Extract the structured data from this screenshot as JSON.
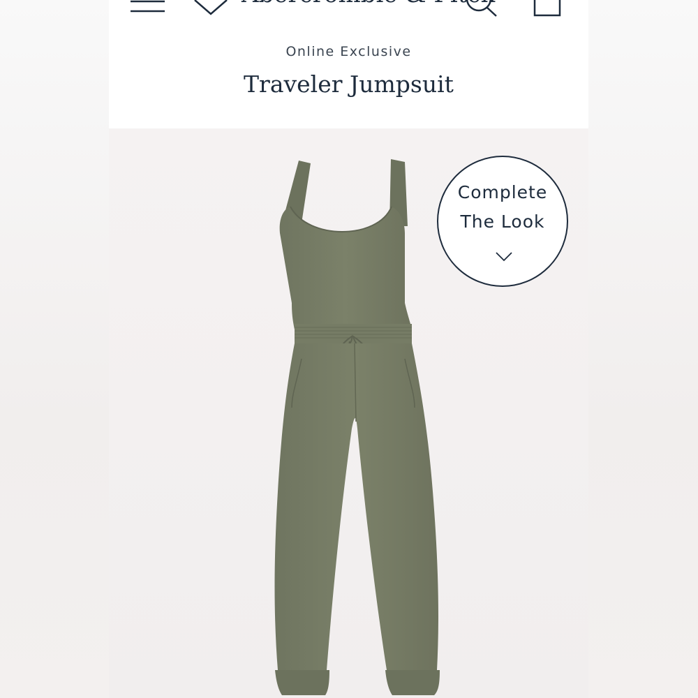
{
  "header": {
    "brand": "Abercrombie & Fitch",
    "icons": [
      "menu-icon",
      "heart-icon",
      "search-icon",
      "bag-icon"
    ]
  },
  "product": {
    "eyebrow": "Online Exclusive",
    "title": "Traveler Jumpsuit"
  },
  "complete_look": {
    "line1": "Complete",
    "line2": "The Look",
    "icon": "chevron-down-icon"
  },
  "colors": {
    "brand_navy": "#1d2b3c",
    "olive": "#777d66"
  }
}
